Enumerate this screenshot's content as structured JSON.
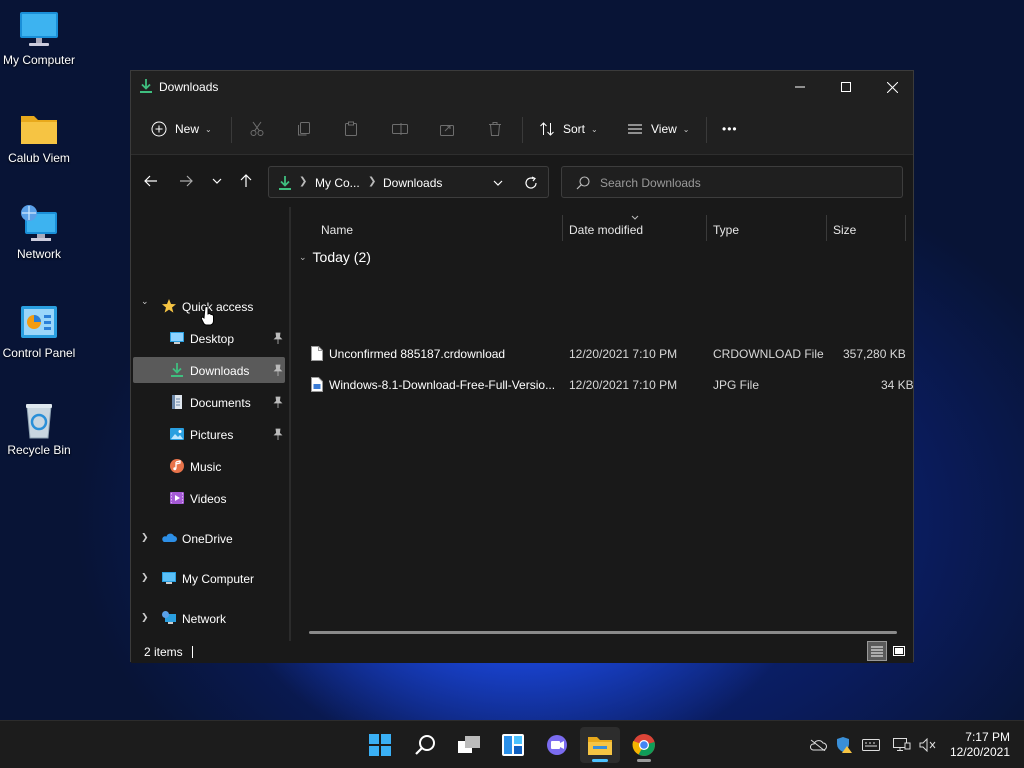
{
  "desktop": {
    "icons": [
      {
        "label": "My Computer",
        "icon": "computer-icon"
      },
      {
        "label": "Calub Viem",
        "icon": "folder-icon"
      },
      {
        "label": "Network",
        "icon": "network-icon"
      },
      {
        "label": "Control Panel",
        "icon": "control-panel-icon"
      },
      {
        "label": "Recycle Bin",
        "icon": "recycle-bin-icon"
      }
    ]
  },
  "window": {
    "title": "Downloads",
    "commandbar": {
      "new_label": "New",
      "sort_label": "Sort",
      "view_label": "View",
      "more_label": "•••"
    },
    "address": {
      "crumbs": [
        "My Co...",
        "Downloads"
      ]
    },
    "search": {
      "placeholder": "Search Downloads"
    },
    "nav": {
      "quick_access": "Quick access",
      "items": [
        {
          "label": "Desktop",
          "pinned": true
        },
        {
          "label": "Downloads",
          "pinned": true,
          "selected": true
        },
        {
          "label": "Documents",
          "pinned": true
        },
        {
          "label": "Pictures",
          "pinned": true
        },
        {
          "label": "Music",
          "pinned": false
        },
        {
          "label": "Videos",
          "pinned": false
        }
      ],
      "roots": [
        {
          "label": "OneDrive"
        },
        {
          "label": "My Computer"
        },
        {
          "label": "Network"
        }
      ]
    },
    "columns": {
      "name": "Name",
      "date": "Date modified",
      "type": "Type",
      "size": "Size"
    },
    "group": {
      "label": "Today (2)"
    },
    "files": [
      {
        "name": "Unconfirmed 885187.crdownload",
        "date": "12/20/2021 7:10 PM",
        "type": "CRDOWNLOAD File",
        "size": "357,280 KB"
      },
      {
        "name": "Windows-8.1-Download-Free-Full-Versio...",
        "date": "12/20/2021 7:10 PM",
        "type": "JPG File",
        "size": "34 KB"
      }
    ],
    "status": {
      "count": "2 items"
    }
  },
  "taskbar": {
    "clock_time": "7:17 PM",
    "clock_date": "12/20/2021"
  },
  "colors": {
    "accent": "#4cc2ff",
    "download_green": "#3fbf7f",
    "folder_yellow": "#f6c443",
    "selected_bg": "#5a5a5a"
  }
}
